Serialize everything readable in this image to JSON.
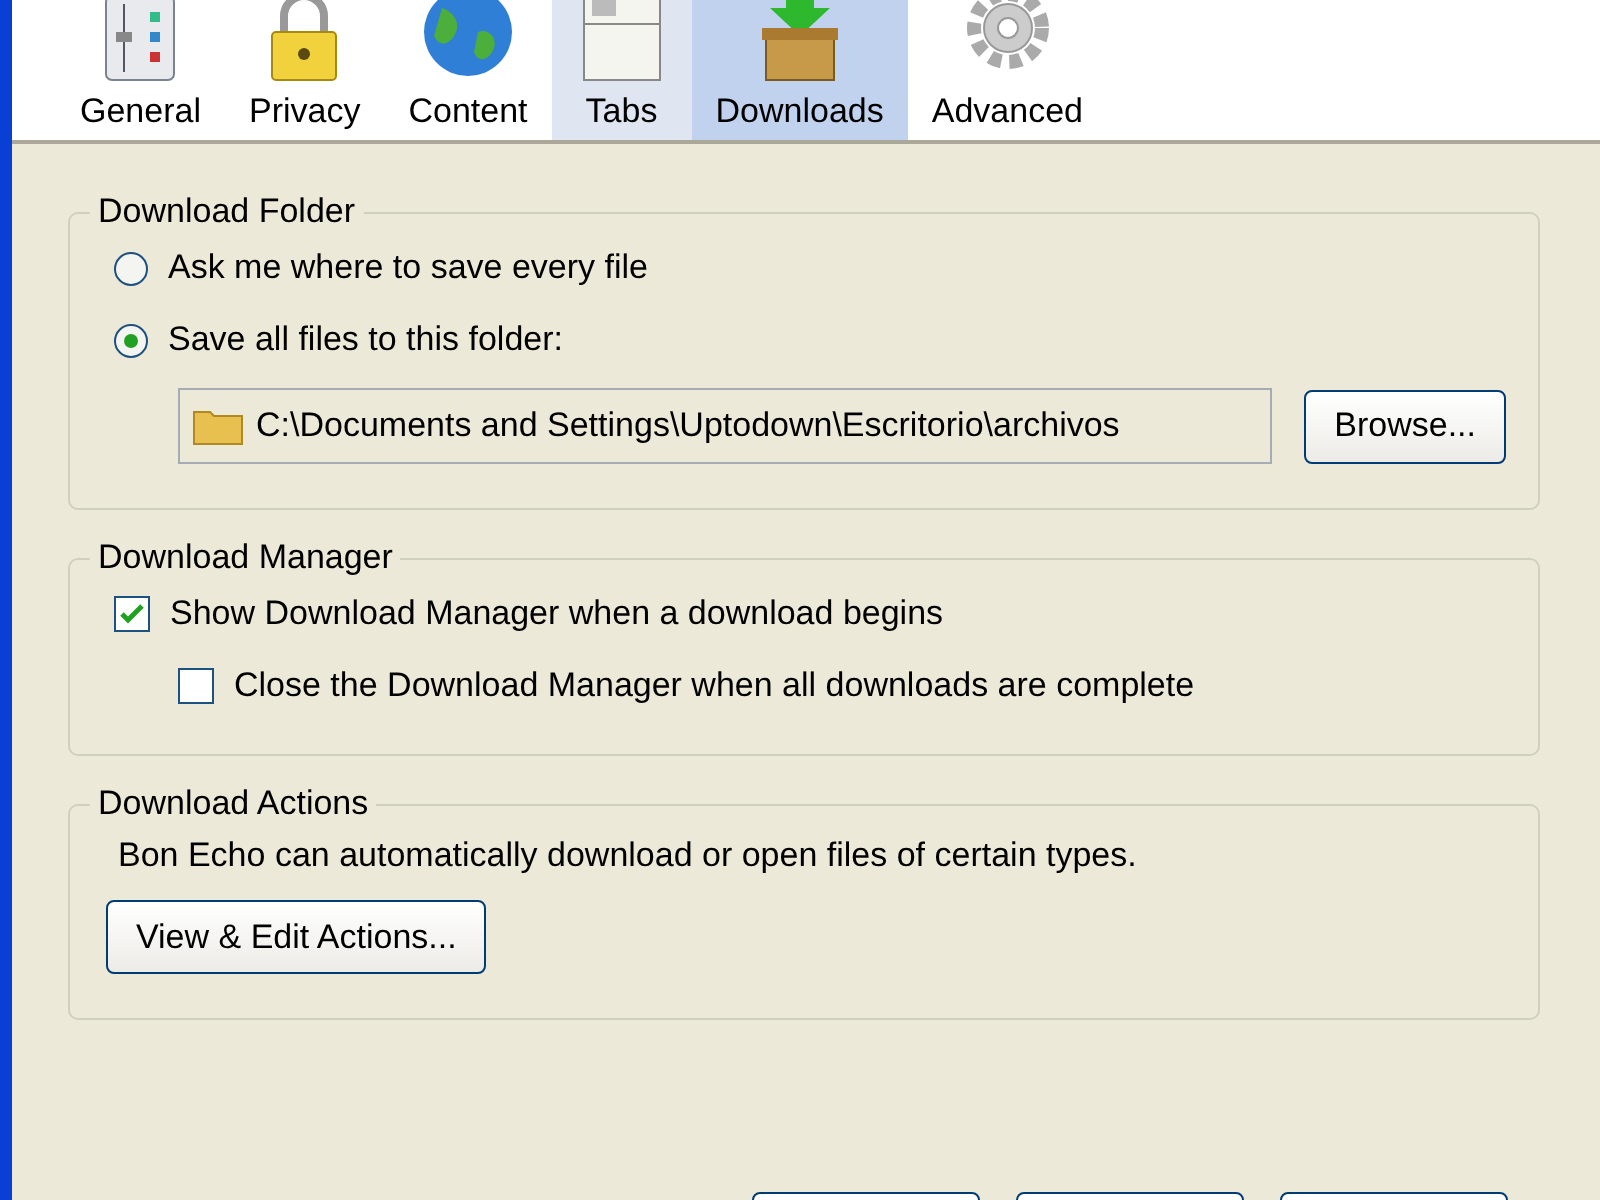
{
  "toolbar": {
    "tabs": [
      {
        "label": "General",
        "selected": false,
        "hovered": false
      },
      {
        "label": "Privacy",
        "selected": false,
        "hovered": false
      },
      {
        "label": "Content",
        "selected": false,
        "hovered": false
      },
      {
        "label": "Tabs",
        "selected": false,
        "hovered": true
      },
      {
        "label": "Downloads",
        "selected": true,
        "hovered": false
      },
      {
        "label": "Advanced",
        "selected": false,
        "hovered": false
      }
    ]
  },
  "groups": [
    {
      "title": "Download Folder",
      "items": [
        {
          "kind": "radio",
          "label": "Ask me where to save every file",
          "selected": false
        },
        {
          "kind": "radio",
          "label": "Save all files to this folder:",
          "selected": true
        },
        {
          "kind": "path",
          "value": "C:\\Documents and Settings\\Uptodown\\Escritorio\\archivos",
          "button": "Browse..."
        }
      ]
    },
    {
      "title": "Download Manager",
      "items": [
        {
          "kind": "checkbox",
          "label": "Show Download Manager when a download begins",
          "checked": true,
          "children": [
            {
              "kind": "checkbox",
              "label": "Close the Download Manager when all downloads are complete",
              "checked": false
            }
          ]
        }
      ]
    },
    {
      "title": "Download Actions",
      "items": [
        {
          "kind": "text",
          "text": "Bon Echo can automatically download or open files of certain types."
        },
        {
          "kind": "button",
          "label": "View & Edit Actions..."
        }
      ]
    }
  ],
  "footer_buttons": [
    {
      "kind": "button"
    },
    {
      "kind": "button"
    },
    {
      "kind": "button"
    }
  ]
}
